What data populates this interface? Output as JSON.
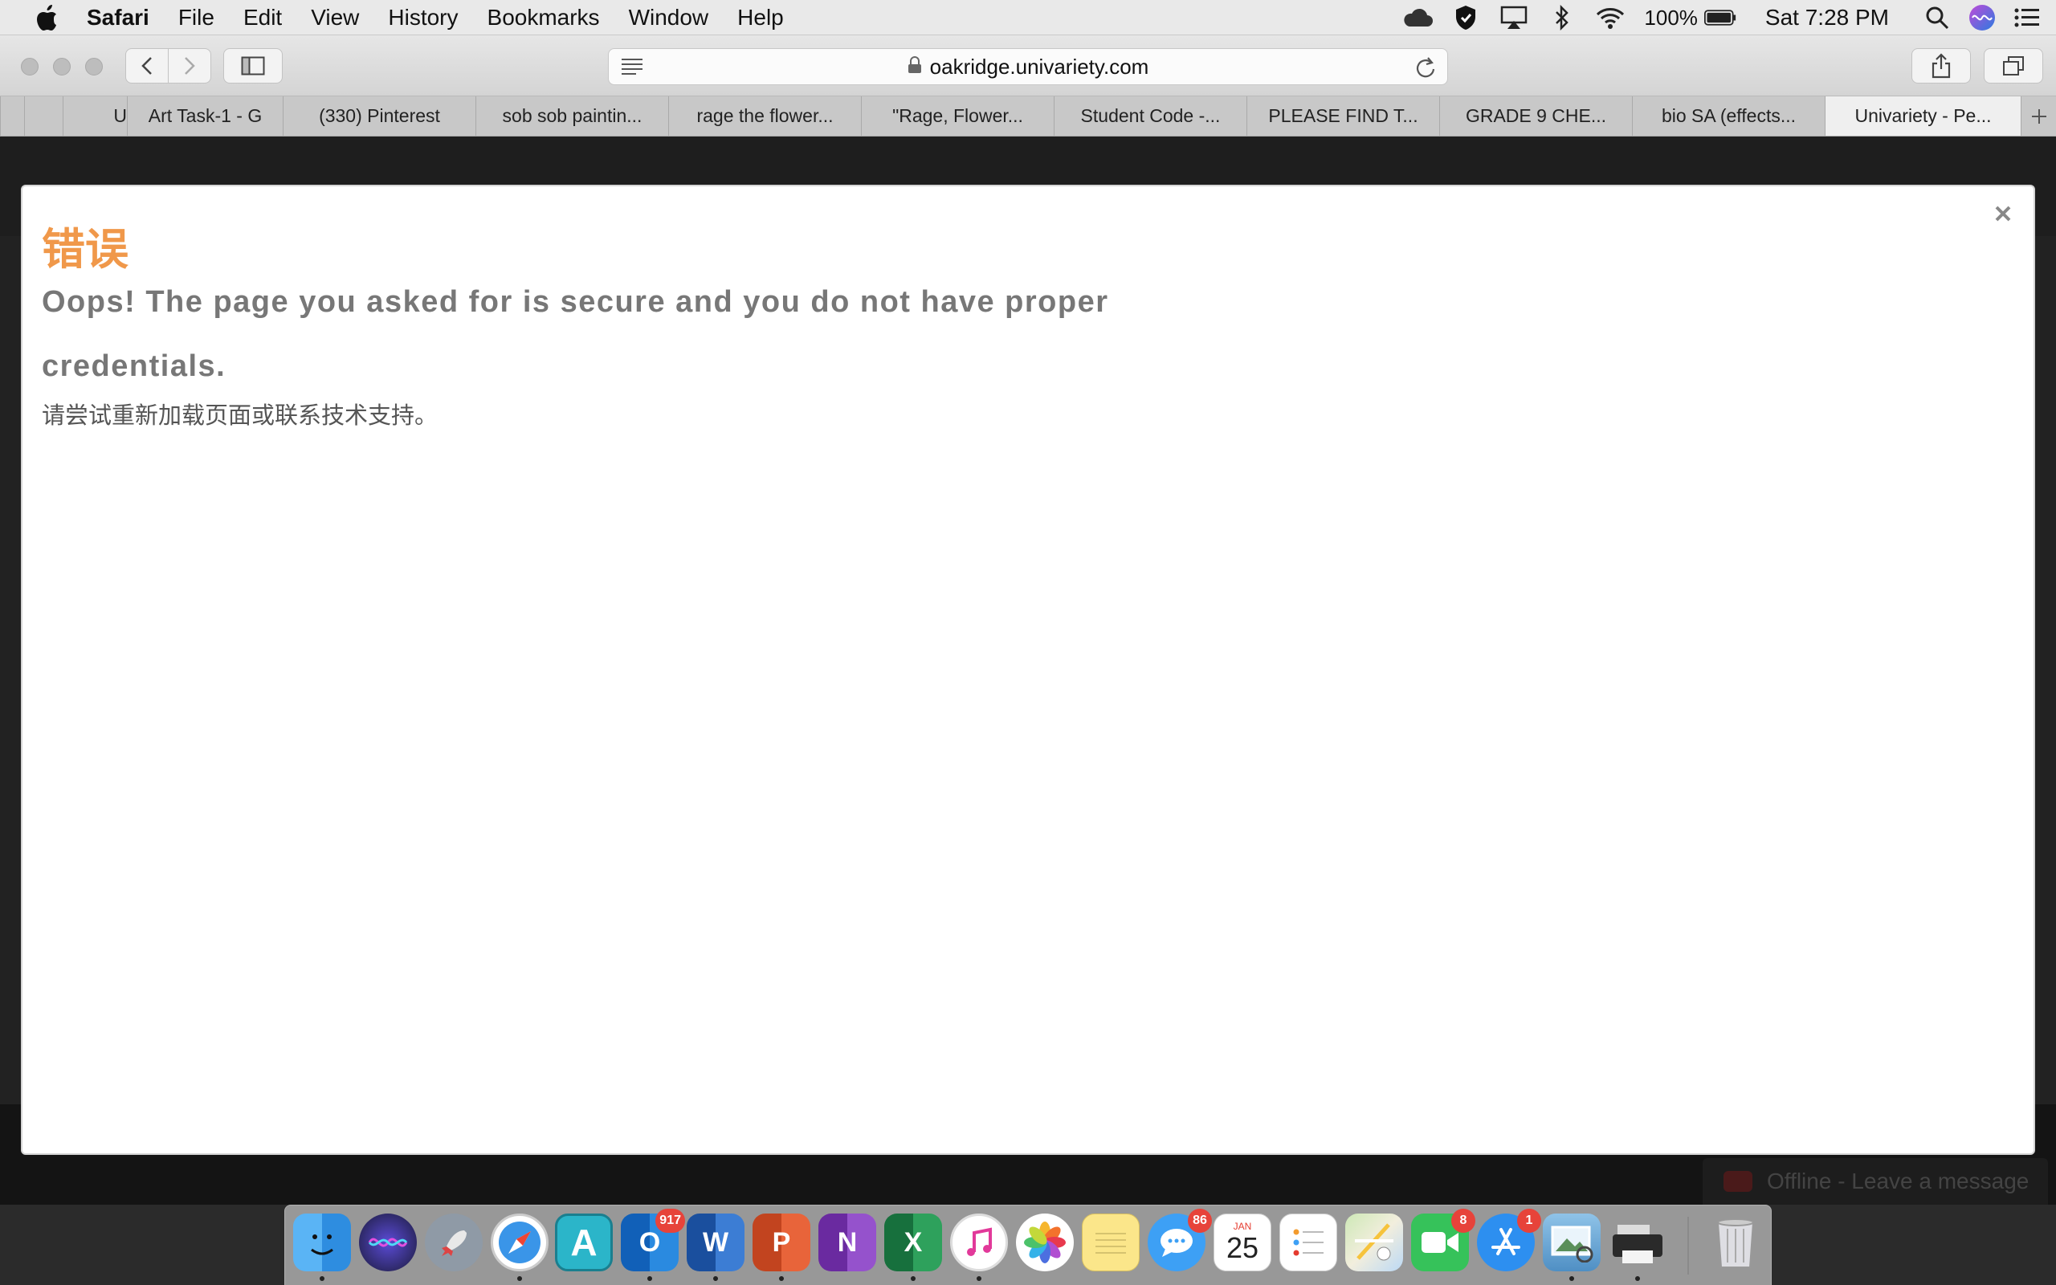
{
  "menubar": {
    "app_name": "Safari",
    "items": [
      "File",
      "Edit",
      "View",
      "History",
      "Bookmarks",
      "Window",
      "Help"
    ],
    "battery": "100%",
    "clock": "Sat 7:28 PM"
  },
  "address": {
    "url": "oakridge.univariety.com"
  },
  "tabs": [
    {
      "label": "U"
    },
    {
      "label": "Art Task-1 - G"
    },
    {
      "label": "(330) Pinterest"
    },
    {
      "label": "sob sob paintin..."
    },
    {
      "label": "rage the flower..."
    },
    {
      "label": "\"Rage, Flower..."
    },
    {
      "label": "Student Code -..."
    },
    {
      "label": "PLEASE FIND T..."
    },
    {
      "label": "GRADE 9 CHE..."
    },
    {
      "label": "bio SA (effects..."
    },
    {
      "label": "Univariety - Pe..."
    }
  ],
  "modal": {
    "title": "错误",
    "message": "Oops! The page you asked for is secure and you do not have proper credentials.",
    "hint": "请尝试重新加载页面或联系技术支持。"
  },
  "chat": {
    "label": "Offline - Leave a message"
  },
  "dock": {
    "badges": {
      "outlook": "917",
      "messages": "86",
      "facetime": "8",
      "appstore": "1"
    },
    "calendar_month": "JAN",
    "calendar_day": "25",
    "letters": {
      "outlook": "O",
      "word": "W",
      "powerpoint": "P",
      "onenote": "N",
      "excel": "X",
      "dictionary": "A"
    }
  },
  "colors": {
    "title_orange": "#f0984a",
    "modal_text": "#777777",
    "page_dark": "#222222"
  }
}
